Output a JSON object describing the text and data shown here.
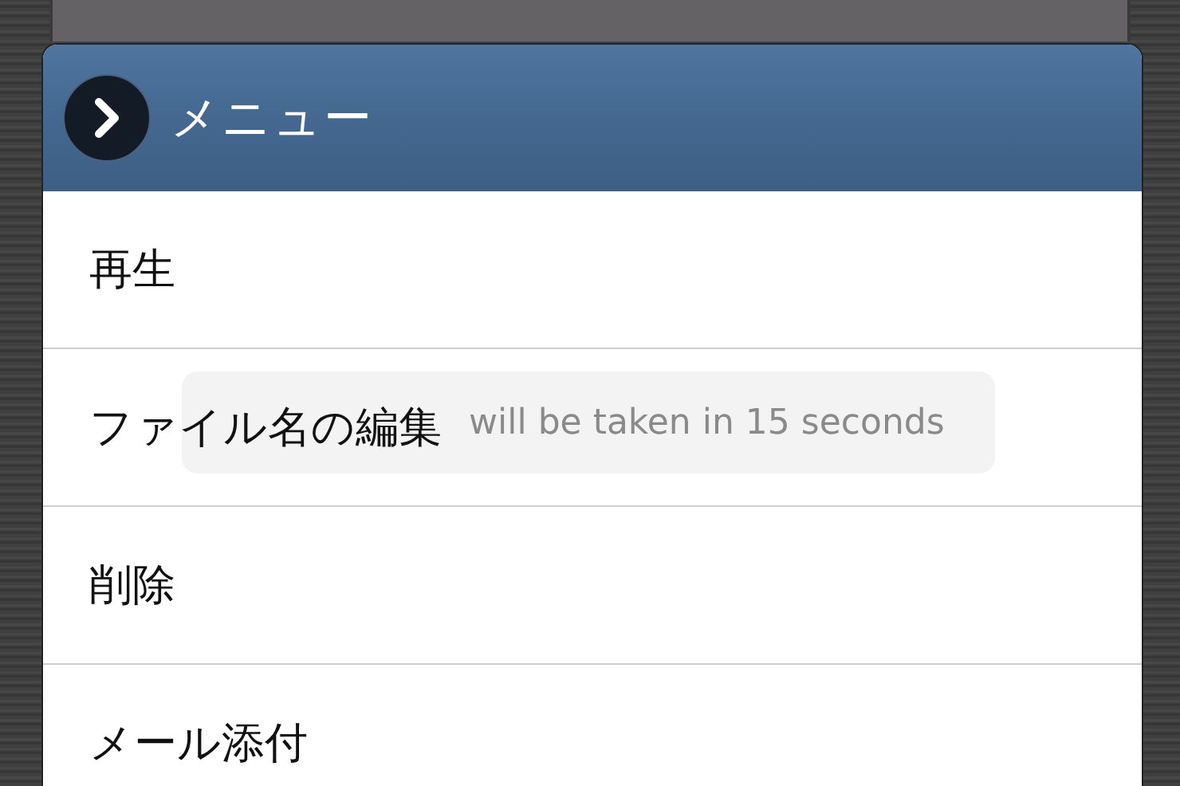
{
  "dialog": {
    "title": "メニュー",
    "items": [
      {
        "label": "再生"
      },
      {
        "label": "ファイル名の編集"
      },
      {
        "label": "削除"
      },
      {
        "label": "メール添付"
      }
    ]
  },
  "toast": {
    "text": "will be taken in 15 seconds"
  }
}
